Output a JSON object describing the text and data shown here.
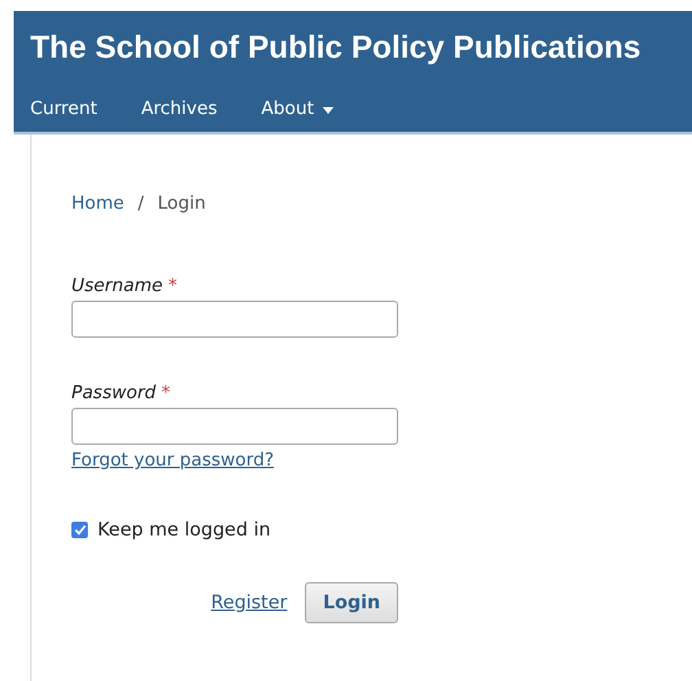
{
  "header": {
    "title": "The School of Public Policy Publications",
    "nav": [
      {
        "label": "Current",
        "dropdown": false
      },
      {
        "label": "Archives",
        "dropdown": false
      },
      {
        "label": "About",
        "dropdown": true
      }
    ]
  },
  "breadcrumb": {
    "links": [
      "Home"
    ],
    "separator": "/",
    "current": "Login"
  },
  "fields": [
    {
      "label": "Username",
      "required_mark": "*"
    },
    {
      "label": "Password",
      "required_mark": "*"
    }
  ],
  "forgot_link": "Forgot your password?",
  "remember": {
    "label": "Keep me logged in",
    "checked": true
  },
  "register_link": "Register",
  "submit_button": "Login"
}
